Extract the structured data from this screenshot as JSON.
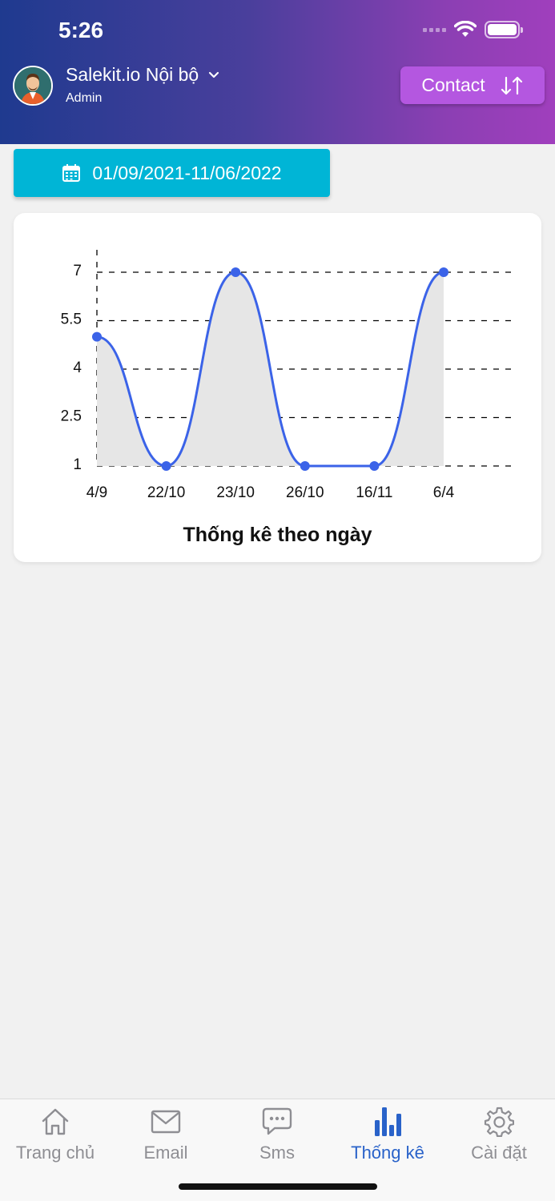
{
  "status_bar": {
    "time": "5:26"
  },
  "header": {
    "org_name": "Salekit.io Nội bộ",
    "role": "Admin",
    "contact_label": "Contact",
    "avatar": "avatar-icon"
  },
  "date_range": {
    "label": "01/09/2021-11/06/2022",
    "icon": "calendar-icon"
  },
  "chart_data": {
    "type": "area",
    "title": "Thống kê theo ngày",
    "categories": [
      "4/9",
      "22/10",
      "23/10",
      "26/10",
      "16/11",
      "6/4"
    ],
    "x_axis_labels": [
      "4/9",
      "22/10",
      "23/10",
      "26/10",
      "16/11",
      "6/4"
    ],
    "y_ticks": [
      "7",
      "5.5",
      "4",
      "2.5",
      "1"
    ],
    "y_tick_values": [
      7,
      5.5,
      4,
      2.5,
      1
    ],
    "series": [
      {
        "values": [
          5,
          1,
          7,
          1,
          1,
          7
        ]
      }
    ],
    "ylim": [
      1,
      7
    ],
    "grid": true,
    "colors": {
      "line": "#3b63e8",
      "fill": "#e6e6e6",
      "grid": "#000000"
    }
  },
  "tabs": [
    {
      "label": "Trang chủ",
      "icon": "home-icon",
      "active": false
    },
    {
      "label": "Email",
      "icon": "mail-icon",
      "active": false
    },
    {
      "label": "Sms",
      "icon": "chat-icon",
      "active": false
    },
    {
      "label": "Thống kê",
      "icon": "bar-chart-icon",
      "active": true
    },
    {
      "label": "Cài đặt",
      "icon": "gear-icon",
      "active": false
    }
  ],
  "colors": {
    "accent": "#2962c9",
    "contact_button": "#b457e0",
    "date_button": "#00b5d6"
  }
}
